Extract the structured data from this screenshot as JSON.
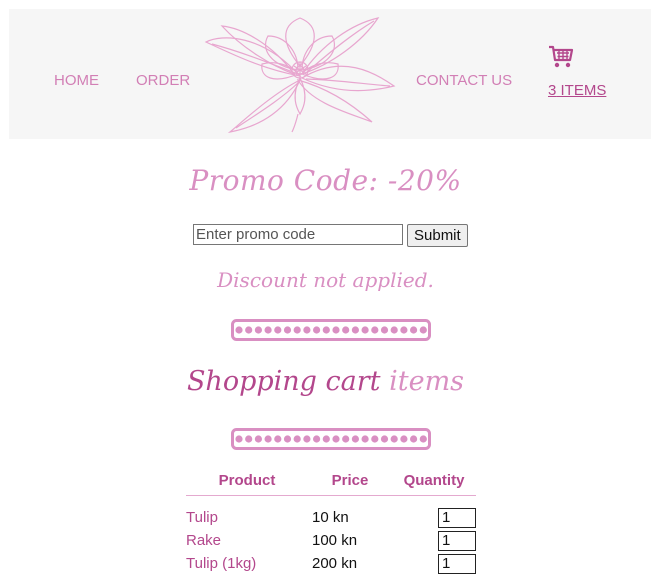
{
  "nav": {
    "home": "HOME",
    "order": "ORDER",
    "contact": "CONTACT US"
  },
  "cart": {
    "count": "3",
    "items_label": "ITEMS",
    "icon": "shopping-cart-icon"
  },
  "promo": {
    "title": "Promo Code: -20%",
    "placeholder": "Enter promo code",
    "submit_label": "Submit",
    "status": "Discount not applied."
  },
  "shopping_cart": {
    "title_main": "Shopping cart",
    "title_light": "items",
    "columns": [
      "Product",
      "Price",
      "Quantity"
    ],
    "rows": [
      {
        "product": "Tulip",
        "price": "10 kn",
        "quantity": "1"
      },
      {
        "product": "Rake",
        "price": "100 kn",
        "quantity": "1"
      },
      {
        "product": "Tulip (1kg)",
        "price": "200 kn",
        "quantity": "1"
      }
    ]
  },
  "colors": {
    "accent": "#b3478c",
    "accent_light": "#d98fc2",
    "header_bg": "#f6f6f6"
  }
}
